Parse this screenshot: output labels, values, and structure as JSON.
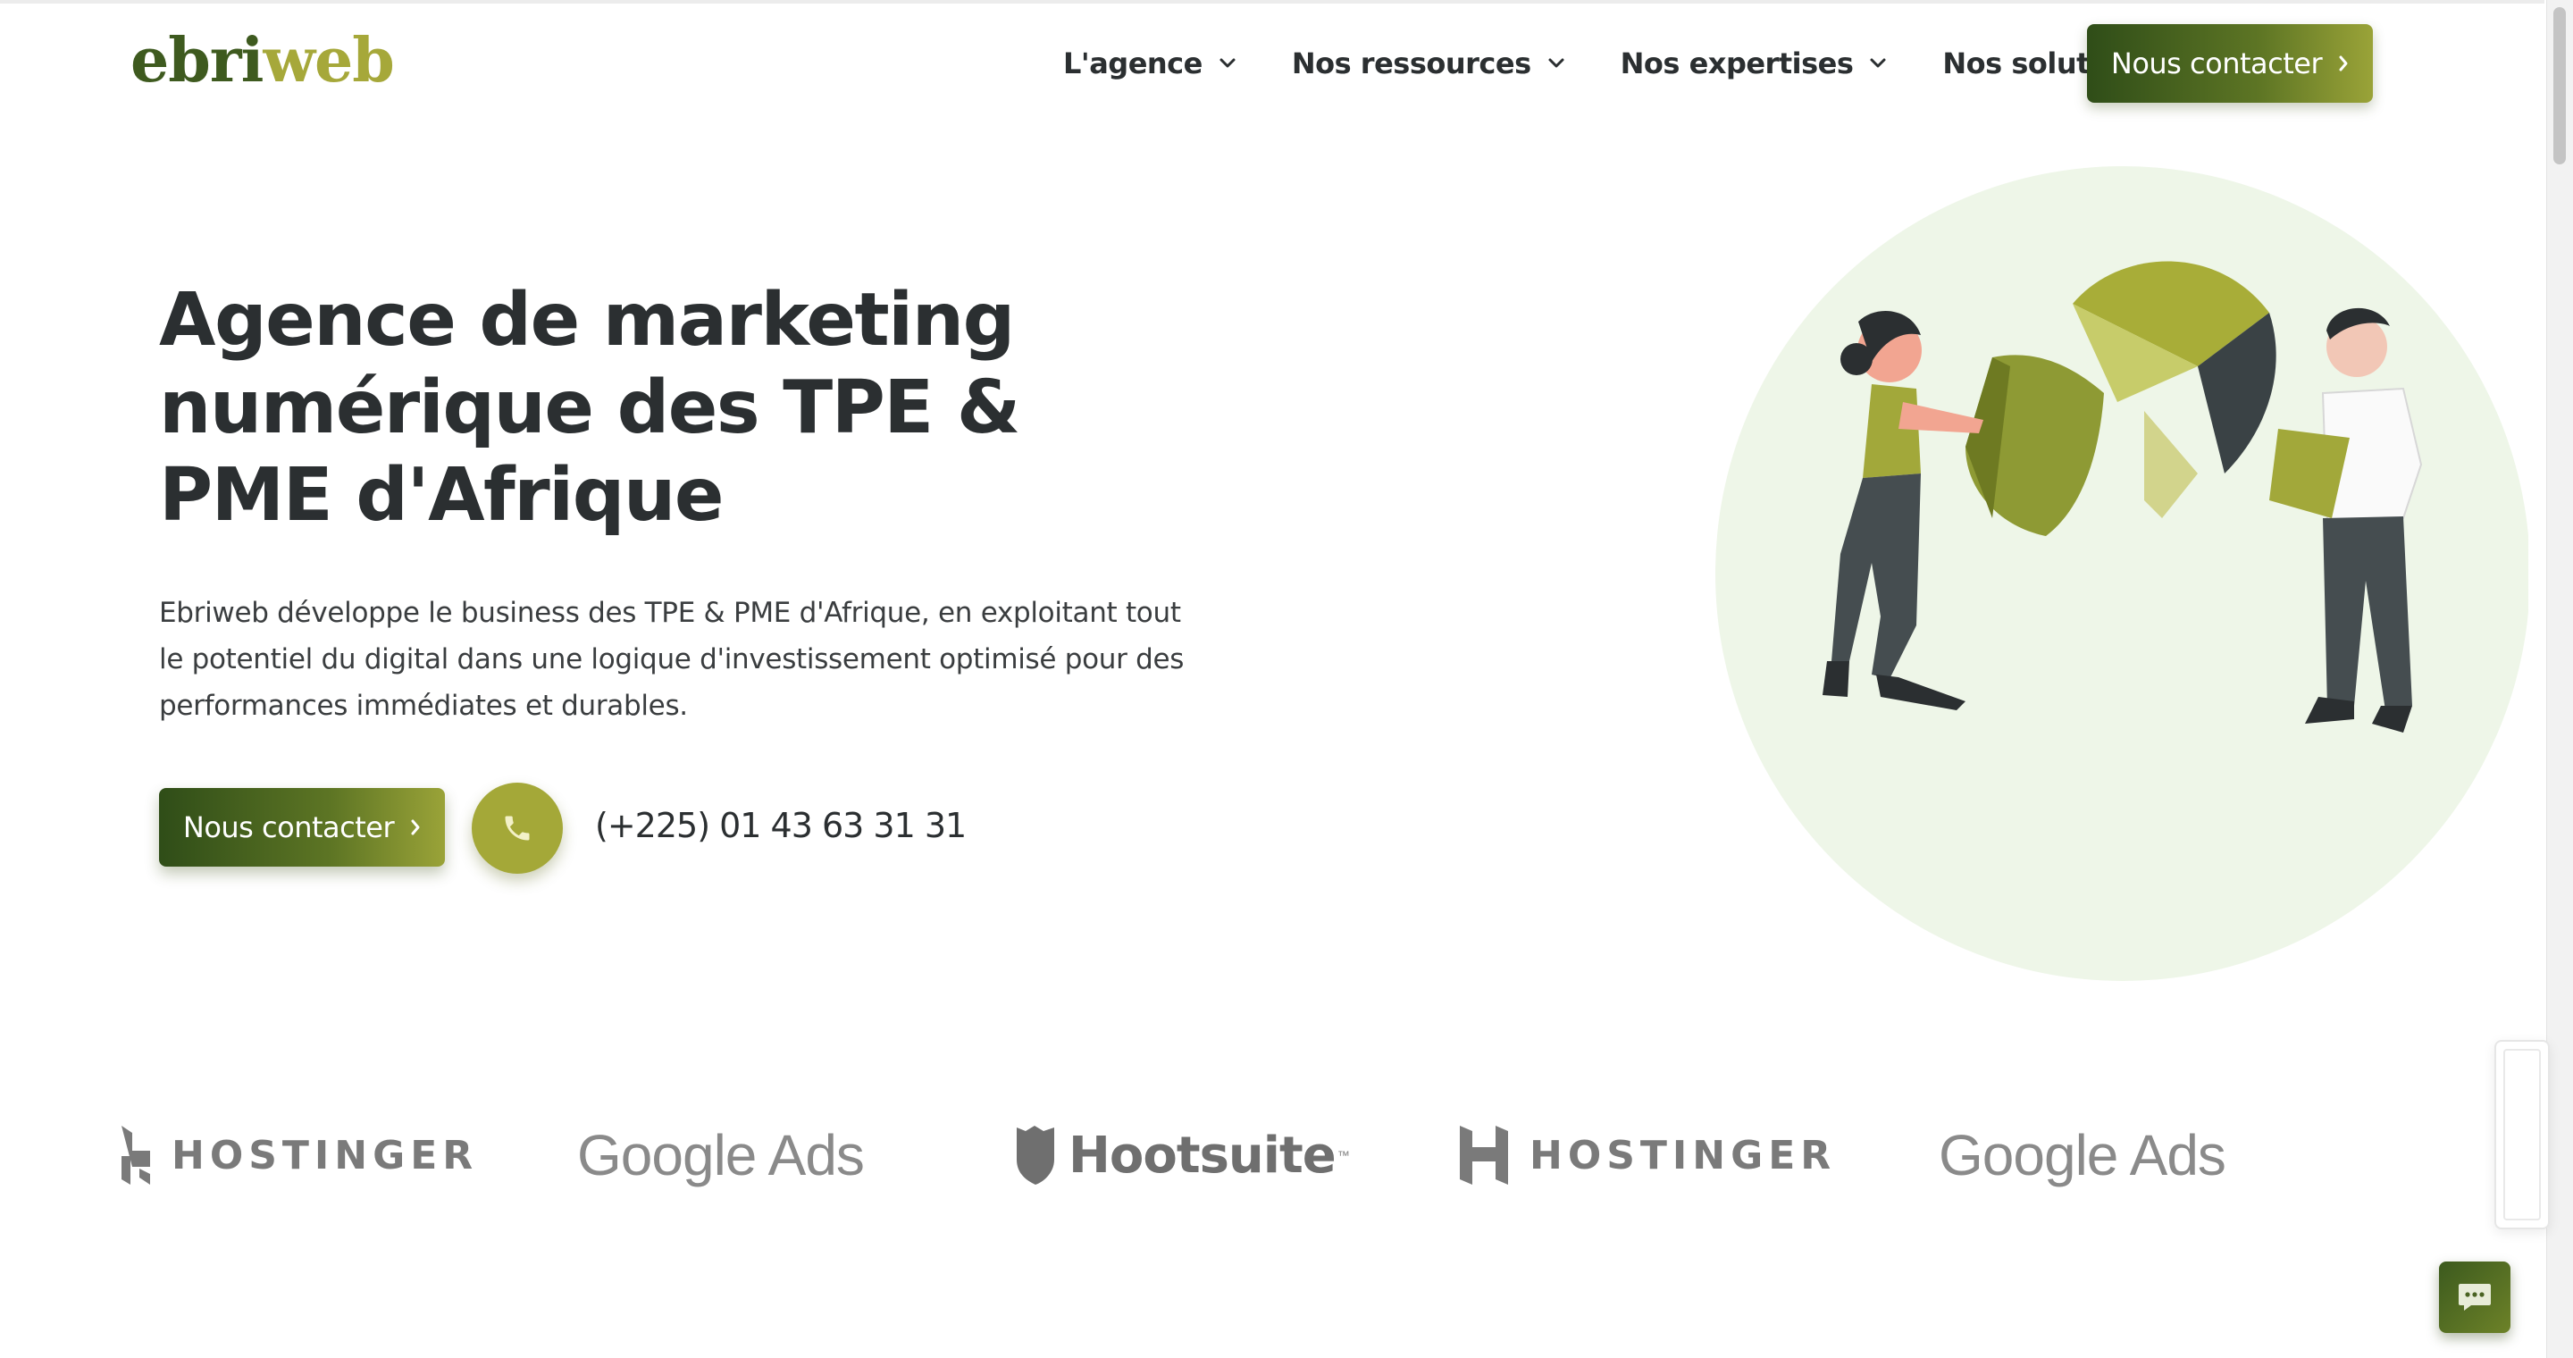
{
  "header": {
    "logo_part1": "ebri",
    "logo_part2": "web",
    "nav": [
      {
        "label": "L'agence"
      },
      {
        "label": "Nos ressources"
      },
      {
        "label": "Nos expertises"
      },
      {
        "label": "Nos solutions"
      }
    ],
    "cta_label": "Nous contacter"
  },
  "hero": {
    "title": "Agence de marketing numérique des TPE & PME d'Afrique",
    "description": "Ebriweb développe le business des TPE & PME d'Afrique, en exploitant tout le potentiel du digital dans une logique d'investissement optimisé pour des performances immédiates et durables.",
    "cta_label": "Nous contacter",
    "phone": "(+225) 01 43 63 31 31"
  },
  "partners": [
    {
      "name": "HOSTINGER"
    },
    {
      "name": "Google Ads"
    },
    {
      "name": "Hootsuite",
      "mark": "™"
    },
    {
      "name": "HOSTINGER"
    },
    {
      "name": "Google Ads"
    }
  ],
  "colors": {
    "brand_dark_green": "#2f4d18",
    "brand_olive": "#a4a838",
    "hero_circle": "#eef6e8",
    "text_dark": "#2b2f31"
  },
  "icons": [
    "chevron-down-icon",
    "chevron-right-icon",
    "phone-icon",
    "chat-icon",
    "hostinger-logo-icon",
    "hootsuite-logo-icon"
  ]
}
